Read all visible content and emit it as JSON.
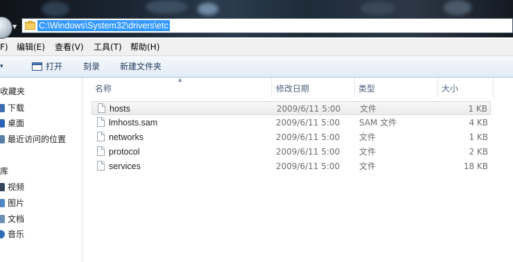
{
  "address": {
    "path": "C:\\Windows\\System32\\drivers\\etc"
  },
  "menu": {
    "file": "F)",
    "edit": "编辑(E)",
    "view": "查看(V)",
    "tools": "工具(T)",
    "help": "帮助(H)"
  },
  "toolbar": {
    "organize_arrow": "▾",
    "open": "打开",
    "burn": "刻录",
    "new_folder": "新建文件夹"
  },
  "nav": {
    "favorites": "收藏夹",
    "download": "下载",
    "desktop": "桌面",
    "recent": "最近访问的位置",
    "libraries": "库",
    "videos": "视频",
    "pictures": "图片",
    "documents": "文档",
    "music": "音乐"
  },
  "columns": {
    "name": "名称",
    "date": "修改日期",
    "type": "类型",
    "size": "大小"
  },
  "files": [
    {
      "name": "hosts",
      "date": "2009/6/11 5:00",
      "type": "文件",
      "size": "1 KB"
    },
    {
      "name": "lmhosts.sam",
      "date": "2009/6/11 5:00",
      "type": "SAM 文件",
      "size": "4 KB"
    },
    {
      "name": "networks",
      "date": "2009/6/11 5:00",
      "type": "文件",
      "size": "1 KB"
    },
    {
      "name": "protocol",
      "date": "2009/6/11 5:00",
      "type": "文件",
      "size": "2 KB"
    },
    {
      "name": "services",
      "date": "2009/6/11 5:00",
      "type": "文件",
      "size": "18 KB"
    }
  ],
  "colors": {
    "selection": "#3399ff",
    "column_header_text": "#4c607a",
    "command_text": "#1e395b"
  }
}
